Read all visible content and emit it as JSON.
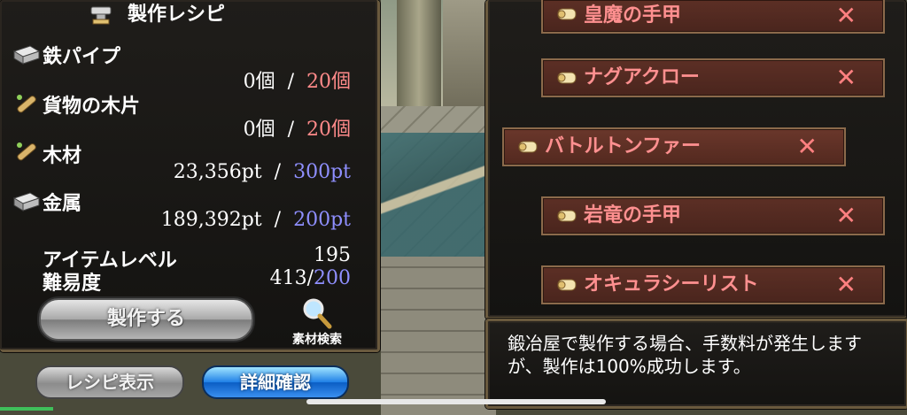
{
  "left_panel": {
    "title": "製作レシピ",
    "materials": [
      {
        "name": "鉄パイプ",
        "icon": "metal-ingot-icon",
        "have": "0個",
        "need": "20個",
        "need_color": "red"
      },
      {
        "name": "貨物の木片",
        "icon": "wood-stick-icon",
        "have": "0個",
        "need": "20個",
        "need_color": "red"
      },
      {
        "name": "木材",
        "icon": "wood-stick-icon",
        "have": "23,356pt",
        "need": "300pt",
        "need_color": "blue"
      },
      {
        "name": "金属",
        "icon": "metal-ingot-icon",
        "have": "189,392pt",
        "need": "200pt",
        "need_color": "blue"
      }
    ],
    "separator": "/",
    "item_level_label": "アイテムレベル",
    "item_level_value": "195",
    "difficulty_label": "難易度",
    "difficulty_value": "413/",
    "difficulty_max": "200",
    "craft_button": "製作する",
    "search_label": "素材検索"
  },
  "bottom_buttons": {
    "recipe_display": "レシピ表示",
    "detail_confirm": "詳細確認"
  },
  "recipe_list": [
    {
      "name": "皇魔の手甲"
    },
    {
      "name": "ナグアクロー"
    },
    {
      "name": "バトルトンファー",
      "selected": true
    },
    {
      "name": "岩竜の手甲"
    },
    {
      "name": "オキュラシーリスト"
    }
  ],
  "remove_symbol": "✕",
  "message": "鍛冶屋で製作する場合、手数料が発生しますが、製作は100%成功します。",
  "colors": {
    "red_value": "#ff8a8a",
    "blue_value": "#8f8fff",
    "recipe_text": "#ff9090",
    "panel_border": "#6a5a3e"
  }
}
